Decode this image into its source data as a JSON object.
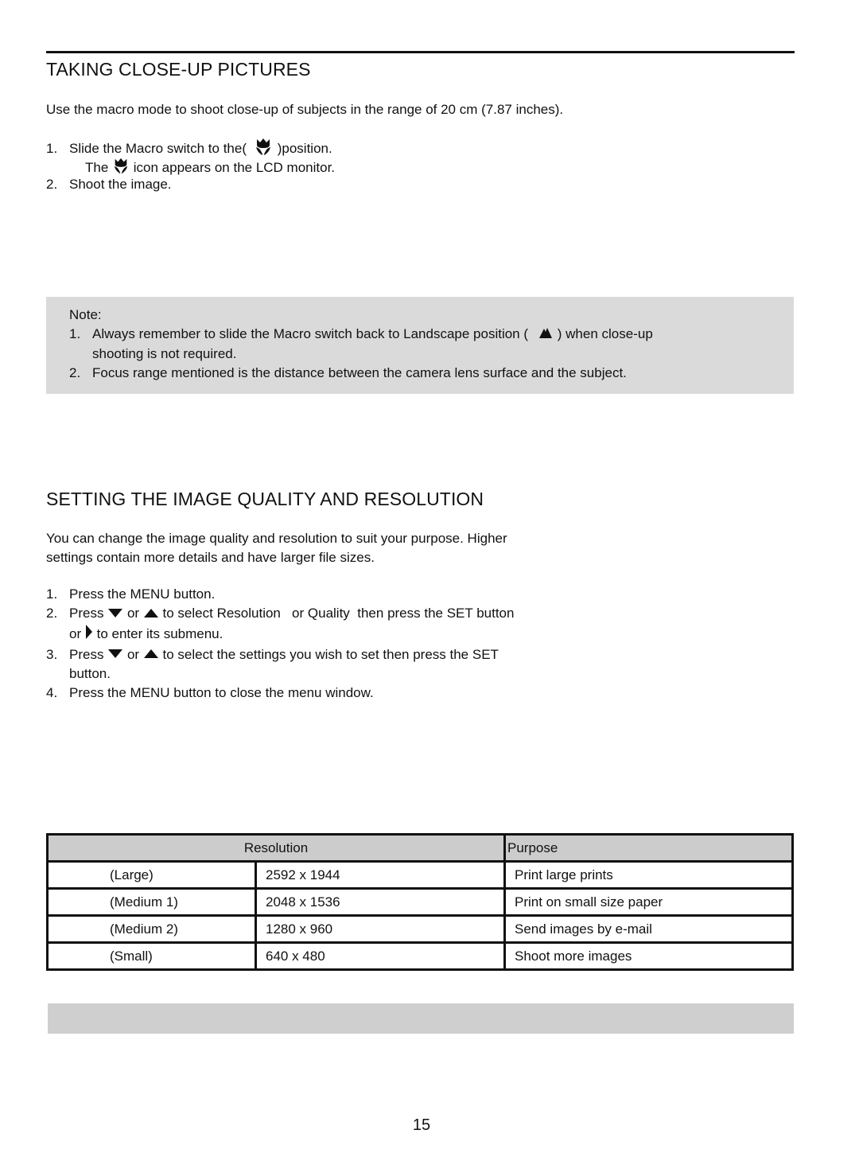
{
  "section1": {
    "title": "TAKING CLOSE-UP PICTURES",
    "intro": "Use the macro mode to shoot close-up of subjects in the range of 20 cm (7.87 inches).",
    "steps": [
      {
        "num": "1.",
        "pre": "Slide the Macro switch to the(",
        "icon": "macro-flower-icon",
        "post": ")position."
      },
      {
        "sub_pre": "The",
        "icon": "macro-flower-icon",
        "sub_post": "icon appears on the LCD monitor."
      },
      {
        "num": "2.",
        "text": "Shoot the image."
      }
    ],
    "note": {
      "label": "Note:",
      "items": [
        {
          "num": "1.",
          "pre": "Always remember to slide the Macro switch back to Landscape position (",
          "icon": "landscape-mountain-icon",
          "post": ") when close-up",
          "cont": "shooting is not required."
        },
        {
          "num": "2.",
          "text": "Focus range mentioned is the distance between the camera lens surface and the subject."
        }
      ]
    }
  },
  "section2": {
    "title": "SETTING THE IMAGE QUALITY AND RESOLUTION",
    "intro_line1": "You can change the image quality and resolution to suit your purpose. Higher",
    "intro_line2": "settings contain more details and have larger file sizes.",
    "steps": [
      {
        "num": "1.",
        "text": "Press the MENU button."
      },
      {
        "num": "2.",
        "press": "Press",
        "or": "or",
        "rest": "to select Resolution   or Quality  then press the SET button",
        "cont_or": "or",
        "cont_rest": "to enter its submenu."
      },
      {
        "num": "3.",
        "press": "Press",
        "or": "or",
        "rest": "to select the settings you wish to set then press the SET",
        "cont": "button."
      },
      {
        "num": "4.",
        "text": "Press the MENU button to close the menu window."
      }
    ],
    "table": {
      "headers": {
        "resolution": "Resolution",
        "purpose": "Purpose"
      },
      "rows": [
        {
          "size": "(Large)",
          "pixels": "2592 x 1944",
          "purpose": "Print large prints"
        },
        {
          "size": "(Medium 1)",
          "pixels": "2048 x 1536",
          "purpose": "Print on small size paper"
        },
        {
          "size": "(Medium 2)",
          "pixels": "1280 x 960",
          "purpose": "Send images by e-mail"
        },
        {
          "size": "(Small)",
          "pixels": "640 x 480",
          "purpose": "Shoot more images"
        }
      ]
    }
  },
  "footer": {
    "page_number": "15"
  }
}
